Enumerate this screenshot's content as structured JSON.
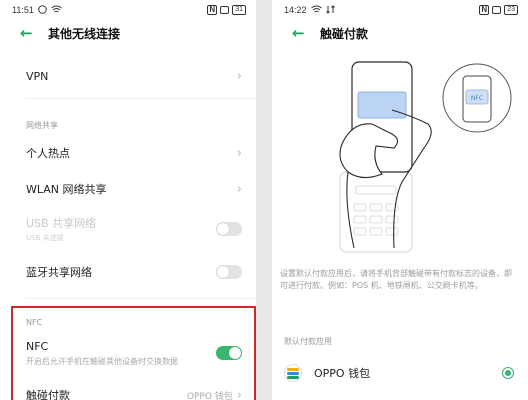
{
  "left": {
    "status": {
      "time": "11:51",
      "nfc": "N",
      "battery": "31"
    },
    "title": "其他无线连接",
    "items": {
      "vpn": "VPN",
      "section_share": "网络共享",
      "hotspot": "个人热点",
      "wlan_share": "WLAN 网络共享",
      "usb_share": "USB 共享网络",
      "usb_sub": "USB 未连接",
      "bt_share": "蓝牙共享网络",
      "section_nfc": "NFC",
      "nfc": "NFC",
      "nfc_sub": "开启后允许手机在触碰其他设备时交换数据",
      "tap_pay": "触碰付款",
      "tap_pay_value": "OPPO 钱包"
    },
    "toggles": {
      "usb_share": false,
      "bt_share": false,
      "nfc": true
    }
  },
  "right": {
    "status": {
      "time": "14:22",
      "nfc": "N",
      "battery": "23"
    },
    "title": "触碰付款",
    "description": "设置默认付款应用后，请将手机背部触碰带有付款标志的设备，即可进行付款。例如：POS 机、地铁闸机、公交刷卡机等。",
    "default_head": "默认付款应用",
    "wallet_label": "OPPO 钱包",
    "wallet_selected": true
  },
  "colors": {
    "accent": "#1aa261",
    "toggle_on": "#3cb56f",
    "highlight": "#c82d2d"
  }
}
